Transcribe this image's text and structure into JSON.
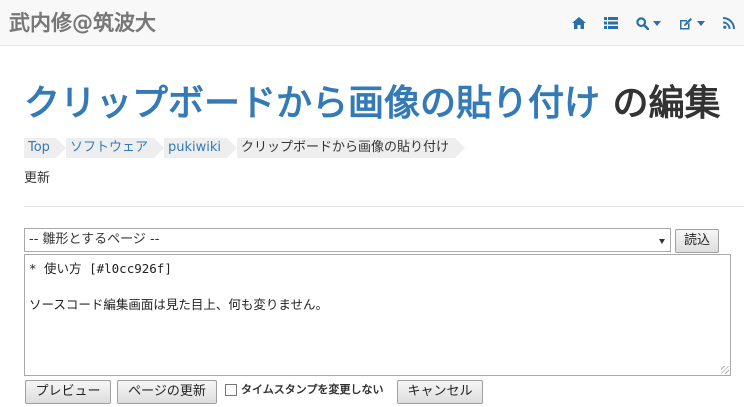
{
  "navbar": {
    "brand": "武内修@筑波大",
    "icons": [
      "home-icon",
      "list-icon",
      "search-icon",
      "edit-icon",
      "rss-icon"
    ]
  },
  "title": {
    "link_text": "クリップボードから画像の貼り付け",
    "suffix": " の編集"
  },
  "breadcrumb": [
    {
      "label": "Top"
    },
    {
      "label": "ソフトウェア"
    },
    {
      "label": "pukiwiki"
    },
    {
      "label": "クリップボードから画像の貼り付け"
    }
  ],
  "update_label": "更新",
  "form": {
    "template_select_value": "-- 雛形とするページ --",
    "load_button": "読込",
    "textarea_value": "* 使い方 [#l0cc926f]\n\nソースコード編集画面は見た目上、何も変りません。",
    "preview_button": "プレビュー",
    "update_button": "ページの更新",
    "timestamp_checkbox_label": "タイムスタンプを変更しない",
    "timestamp_checked": false,
    "cancel_button": "キャンセル"
  },
  "colors": {
    "link": "#337ab7",
    "navbar_bg": "#f8f8f8",
    "nav_icon": "#2a6fa8"
  }
}
